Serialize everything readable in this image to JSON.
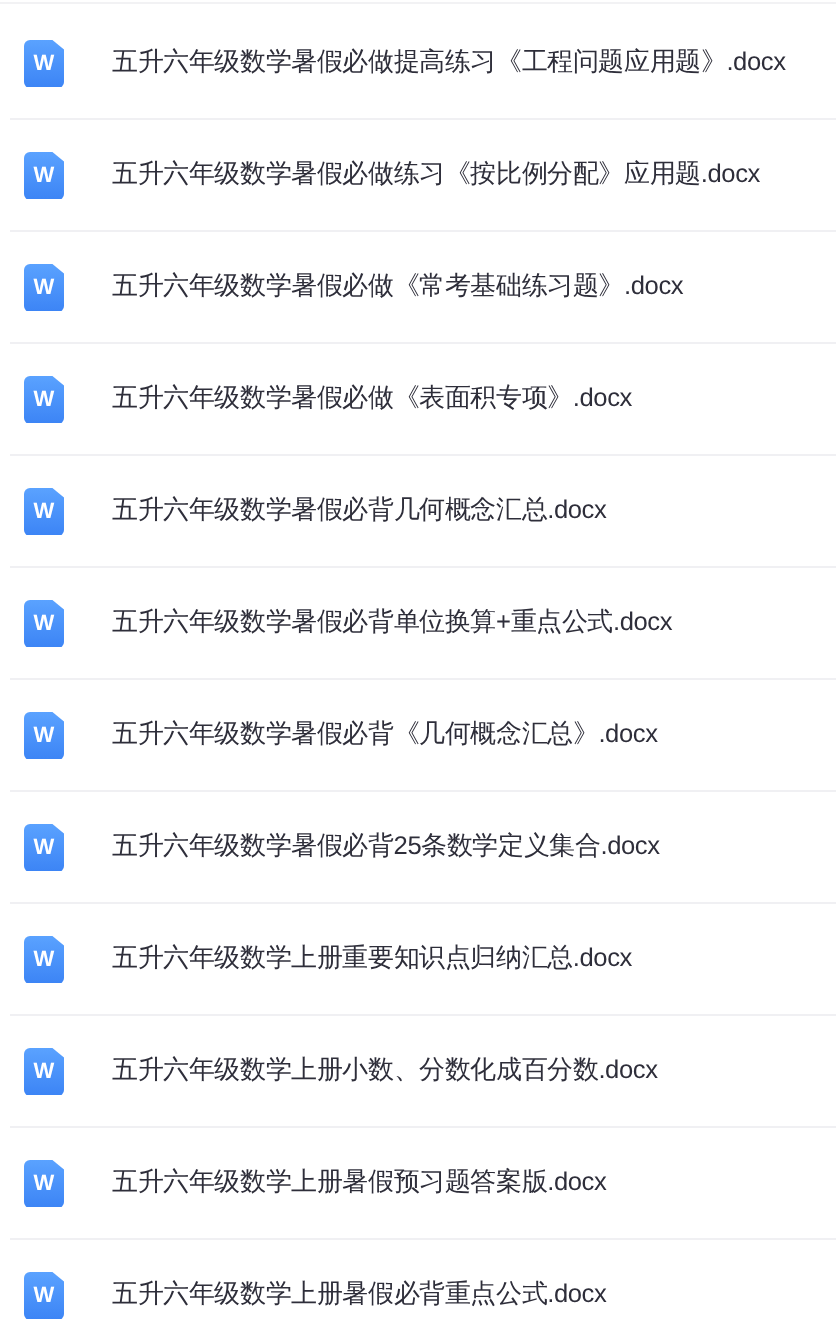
{
  "files": [
    {
      "name": "五升六年级数学暑假必做提高练习《工程问题应用题》.docx",
      "icon_label": "W"
    },
    {
      "name": "五升六年级数学暑假必做练习《按比例分配》应用题.docx",
      "icon_label": "W"
    },
    {
      "name": "五升六年级数学暑假必做《常考基础练习题》.docx",
      "icon_label": "W"
    },
    {
      "name": "五升六年级数学暑假必做《表面积专项》.docx",
      "icon_label": "W"
    },
    {
      "name": "五升六年级数学暑假必背几何概念汇总.docx",
      "icon_label": "W"
    },
    {
      "name": "五升六年级数学暑假必背单位换算+重点公式.docx",
      "icon_label": "W"
    },
    {
      "name": "五升六年级数学暑假必背《几何概念汇总》.docx",
      "icon_label": "W"
    },
    {
      "name": "五升六年级数学暑假必背25条数学定义集合.docx",
      "icon_label": "W"
    },
    {
      "name": "五升六年级数学上册重要知识点归纳汇总.docx",
      "icon_label": "W"
    },
    {
      "name": "五升六年级数学上册小数、分数化成百分数.docx",
      "icon_label": "W"
    },
    {
      "name": "五升六年级数学上册暑假预习题答案版.docx",
      "icon_label": "W"
    },
    {
      "name": "五升六年级数学上册暑假必背重点公式.docx",
      "icon_label": "W"
    }
  ]
}
